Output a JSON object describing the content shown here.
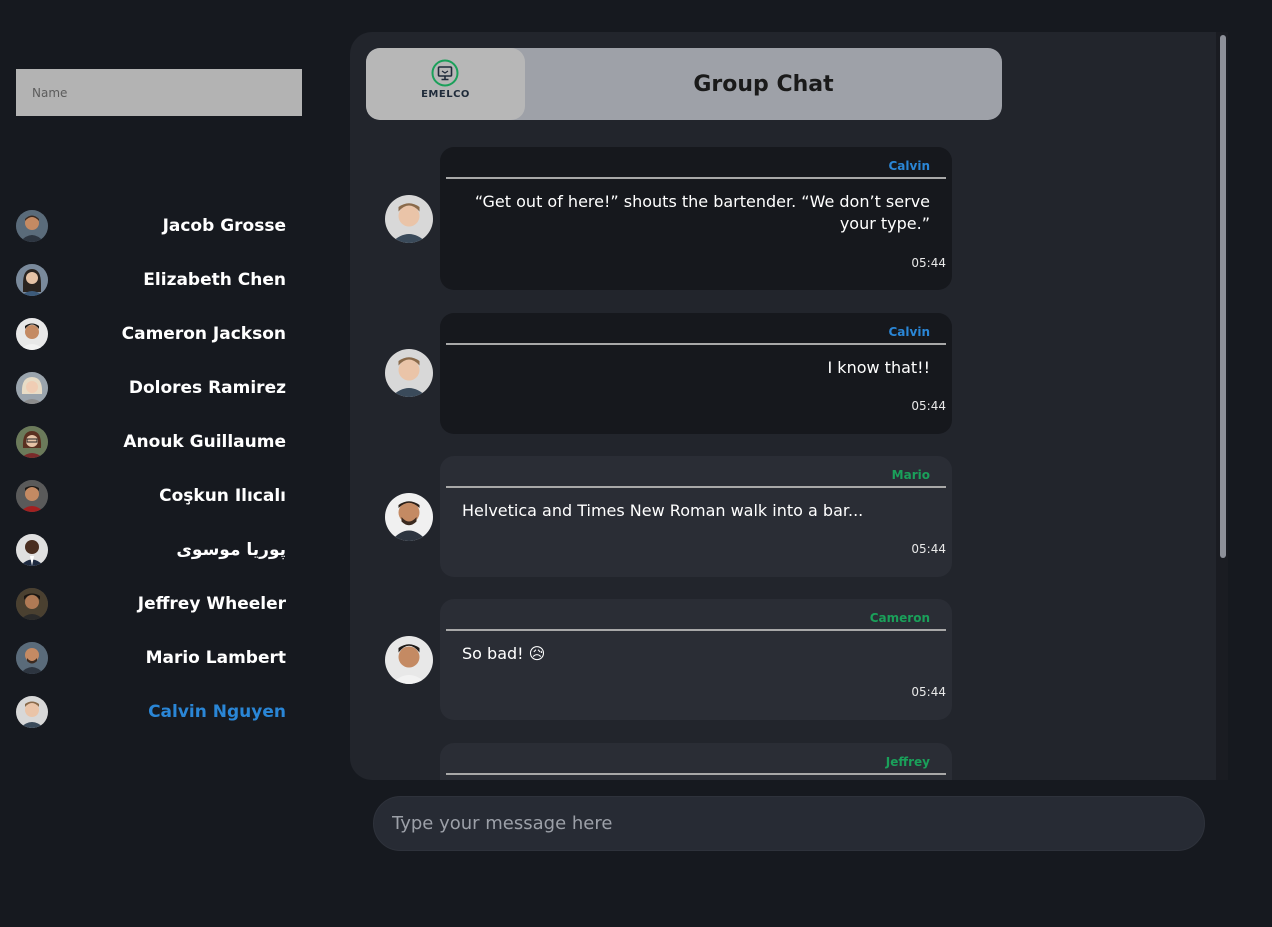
{
  "sidebar": {
    "name_placeholder": "Name",
    "users": [
      {
        "name": "Jacob Grosse"
      },
      {
        "name": "Elizabeth Chen"
      },
      {
        "name": "Cameron Jackson"
      },
      {
        "name": "Dolores Ramirez"
      },
      {
        "name": "Anouk Guillaume"
      },
      {
        "name": "Coşkun Ilıcalı"
      },
      {
        "name": "پوریا موسوی"
      },
      {
        "name": "Jeffrey Wheeler"
      },
      {
        "name": "Mario Lambert"
      },
      {
        "name": "Calvin Nguyen",
        "active": true
      }
    ]
  },
  "header": {
    "logo_text": "EMELCO",
    "title": "Group Chat"
  },
  "messages": [
    {
      "sender": "Calvin",
      "text": "“Get out of here!” shouts the bartender. “We don’t serve your type.”",
      "time": "05:44",
      "self": true
    },
    {
      "sender": "Calvin",
      "text": "I know that!!",
      "time": "05:44",
      "self": true
    },
    {
      "sender": "Mario",
      "text": "Helvetica and Times New Roman walk into a bar...",
      "time": "05:44",
      "self": false
    },
    {
      "sender": "Cameron",
      "text": "So bad! 😥",
      "time": "05:44",
      "self": false
    },
    {
      "sender": "Jeffrey",
      "text": "",
      "time": "",
      "self": false
    }
  ],
  "composer": {
    "placeholder": "Type your message here"
  },
  "colors": {
    "background": "#16191f",
    "panel": "#22252c",
    "self_sender": "#2a86d6",
    "other_sender": "#1aa05a",
    "active_user": "#2a86d6"
  }
}
